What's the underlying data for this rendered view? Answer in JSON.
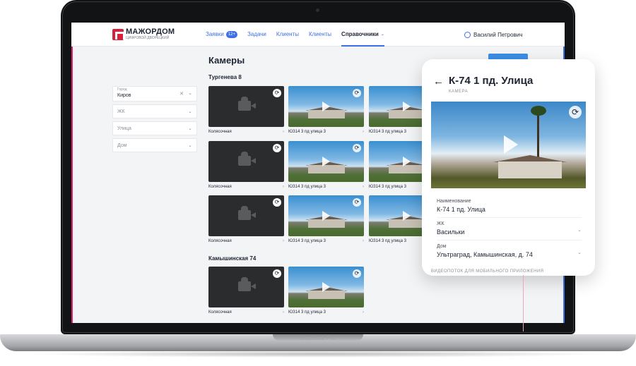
{
  "device": {
    "label": "MacBook Pro"
  },
  "header": {
    "logo_name": "МАЖОРДОМ",
    "logo_sub": "ЦИФРОВОЙ ДВОРЕЦКИЙ",
    "nav": [
      {
        "label": "Заявки",
        "badge": "12+"
      },
      {
        "label": "Задачи"
      },
      {
        "label": "Клиенты"
      },
      {
        "label": "Клиенты"
      },
      {
        "label": "Справочники",
        "active": true
      }
    ],
    "user": "Василий Петрович"
  },
  "filters": {
    "city_label": "Город",
    "city_value": "Киров",
    "complex_placeholder": "ЖК",
    "street_placeholder": "Улица",
    "house_placeholder": "Дом"
  },
  "page": {
    "title": "Камеры"
  },
  "groups": [
    {
      "title": "Тургенева 8",
      "rows": [
        [
          {
            "caption": "Колясочная",
            "kind": "dark"
          },
          {
            "caption": "ЮЗ14 3 пд улица 3",
            "kind": "photo"
          },
          {
            "caption": "ЮЗ14 3 пд улица 3",
            "kind": "photo"
          }
        ],
        [
          {
            "caption": "Колясочная",
            "kind": "dark"
          },
          {
            "caption": "ЮЗ14 3 пд улица 3",
            "kind": "photo"
          },
          {
            "caption": "ЮЗ14 3 пд улица 3",
            "kind": "photo"
          }
        ],
        [
          {
            "caption": "Колясочная",
            "kind": "dark"
          },
          {
            "caption": "ЮЗ14 3 пд улица 3",
            "kind": "photo"
          },
          {
            "caption": "ЮЗ14 3 пд улица 3",
            "kind": "photo"
          }
        ]
      ]
    },
    {
      "title": "Камышинская 74",
      "rows": [
        [
          {
            "caption": "Колясочная",
            "kind": "dark"
          },
          {
            "caption": "ЮЗ14 3 пд улица 3",
            "kind": "photo"
          }
        ]
      ]
    }
  ],
  "detail": {
    "title": "К-74 1 пд. Улица",
    "subtitle": "КАМЕРА",
    "fields": [
      {
        "label": "Наименование",
        "value": "К-74 1 пд. Улица",
        "select": false
      },
      {
        "label": "ЖК",
        "value": "Васильки",
        "select": true
      },
      {
        "label": "Дом",
        "value": "Ультраград, Камышинская, д. 74",
        "select": true
      }
    ],
    "section_label": "ВИДЕОПОТОК ДЛЯ МОБИЛЬНОГО ПРИЛОЖЕНИЯ"
  },
  "colors": {
    "accent": "#3d6fe6",
    "brand": "#d81f3c",
    "dark_tile": "#2b2c2e"
  }
}
